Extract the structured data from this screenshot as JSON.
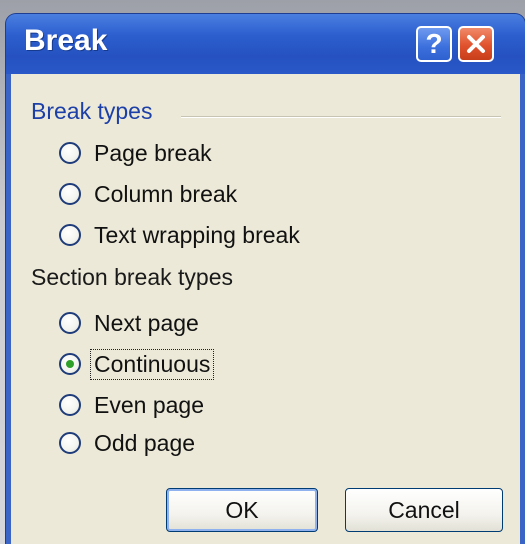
{
  "dialog": {
    "title": "Break",
    "help_button": "?",
    "close_button": "close"
  },
  "break_types": {
    "header": "Break types",
    "options": [
      {
        "label": "Page break",
        "checked": false
      },
      {
        "label": "Column break",
        "checked": false
      },
      {
        "label": "Text wrapping break",
        "checked": false
      }
    ]
  },
  "section_break_types": {
    "header": "Section break types",
    "options": [
      {
        "label": "Next page",
        "checked": false
      },
      {
        "label": "Continuous",
        "checked": true
      },
      {
        "label": "Even page",
        "checked": false
      },
      {
        "label": "Odd page",
        "checked": false
      }
    ]
  },
  "buttons": {
    "ok": "OK",
    "cancel": "Cancel"
  },
  "colors": {
    "titlebar": "#2a58c8",
    "client_bg": "#ece9d8",
    "group_header": "#1c3fa8",
    "radio_checked": "#2ea02a",
    "close_button": "#e0512c"
  }
}
